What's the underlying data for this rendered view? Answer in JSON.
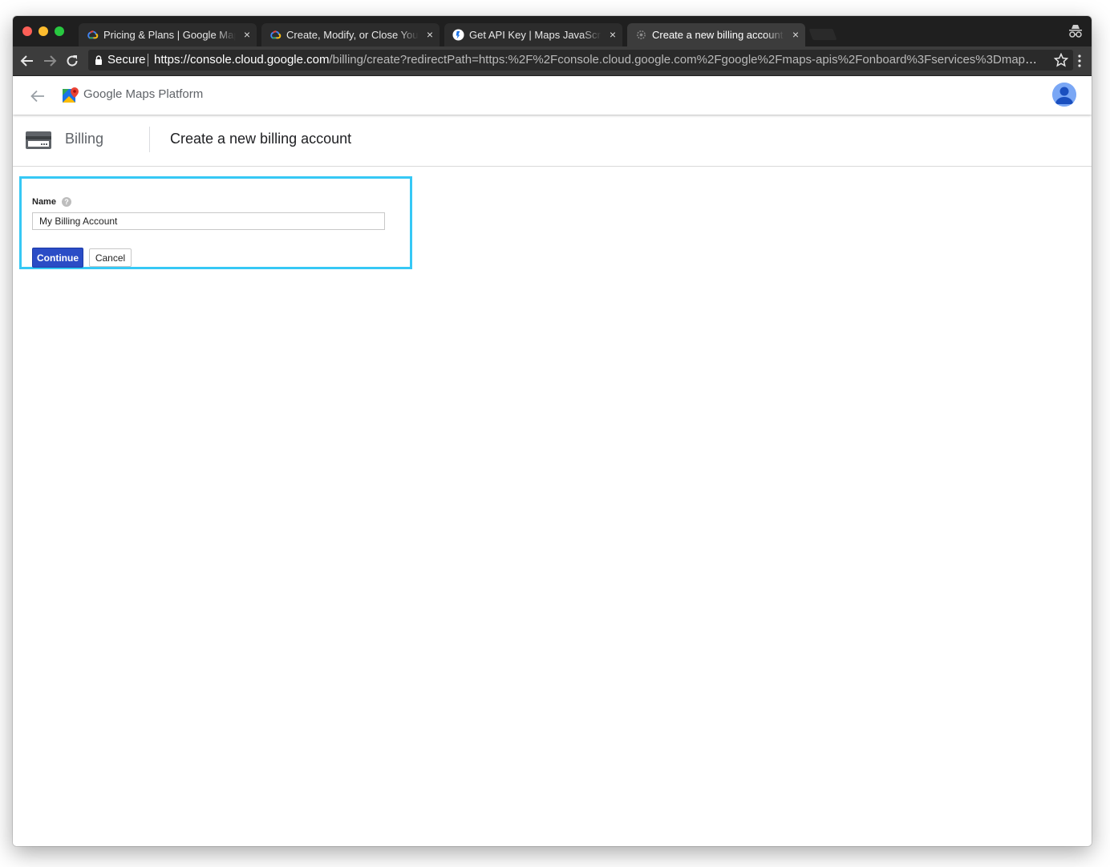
{
  "browser": {
    "tabs": [
      {
        "title": "Pricing & Plans | Google Maps",
        "active": false,
        "favicon": "google-cloud-icon"
      },
      {
        "title": "Create, Modify, or Close Your B",
        "active": false,
        "favicon": "google-cloud-icon"
      },
      {
        "title": "Get API Key  |  Maps JavaScrip",
        "active": false,
        "favicon": "google-developers-icon"
      },
      {
        "title": "Create a new billing account -",
        "active": true,
        "favicon": "loading-gear-icon"
      }
    ],
    "tab_close_glyph": "×",
    "omnibox": {
      "secure_label": "Secure",
      "url_host": "https://console.cloud.google.com",
      "url_path": "/billing/create?redirectPath=https:%2F%2Fconsole.cloud.google.com%2Fgoogle%2Fmaps-apis%2Fonboard%3Fservices%3Dmaps-bac..."
    }
  },
  "app": {
    "brand_google": "Google",
    "brand_product": "Maps Platform"
  },
  "subheader": {
    "section": "Billing",
    "title": "Create a new billing account"
  },
  "form": {
    "name_label": "Name",
    "help_glyph": "?",
    "name_value": "My Billing Account",
    "continue_label": "Continue",
    "cancel_label": "Cancel"
  },
  "colors": {
    "highlight_border": "#36c8f5",
    "primary_button": "#2a4cc6",
    "tab_strip": "#1f1f1f",
    "toolbar": "#3c3c3c"
  }
}
